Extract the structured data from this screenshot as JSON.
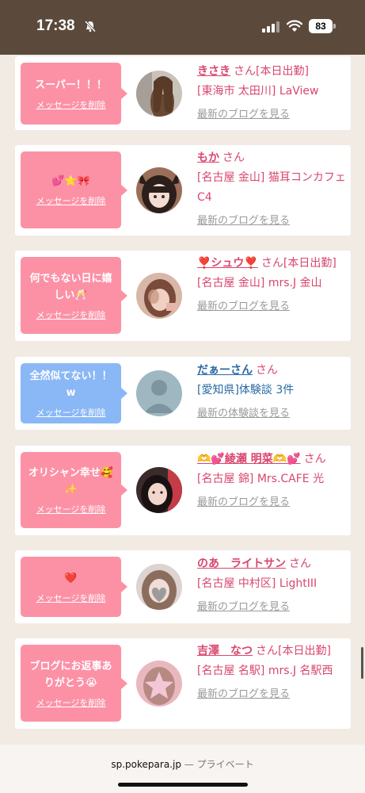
{
  "status": {
    "time": "17:38",
    "battery": "83"
  },
  "feed": [
    {
      "message": "スーパー！！！",
      "delete_label": "メッセージを削除",
      "name": "きさき",
      "san": "さん",
      "badge": "[本日出勤]",
      "detail": "[東海市 太田川] LaView",
      "link": "最新のブログを見る"
    },
    {
      "message": "💕⭐🎀",
      "delete_label": "メッセージを削除",
      "name": "もか",
      "san": "さん",
      "badge": "",
      "detail": "[名古屋 金山] 猫耳コンカフェ C4",
      "link": "最新のブログを見る"
    },
    {
      "message": "何でもない日に嬉しい🥂",
      "delete_label": "メッセージを削除",
      "name": "❣️シュウ❣️",
      "san": "さん",
      "badge": "[本日出勤]",
      "detail": "[名古屋 金山] mrs.J 金山",
      "link": "最新のブログを見る"
    },
    {
      "message": "全然似てない！！w",
      "delete_label": "メッセージを削除",
      "name": "だぁーさん",
      "san": "さん",
      "badge": "",
      "detail": "[愛知県]体験談 3件",
      "link": "最新の体験談を見る"
    },
    {
      "message": "オリシャン幸せ🥰✨",
      "delete_label": "メッセージを削除",
      "name": "🫶💕綾瀬 明菜🫶💕",
      "san": "さん",
      "badge": "",
      "detail": "[名古屋 錦] Mrs.CAFE 光",
      "link": "最新のブログを見る"
    },
    {
      "message": "❤️",
      "delete_label": "メッセージを削除",
      "name": "のあ　ライトサン",
      "san": "さん",
      "badge": "",
      "detail": "[名古屋 中村区] LightIII",
      "link": "最新のブログを見る"
    },
    {
      "message": "ブログにお返事ありがとう😭",
      "delete_label": "メッセージを削除",
      "name": "吉澤　なつ",
      "san": "さん",
      "badge": "[本日出勤]",
      "detail": "[名古屋 名駅] mrs.J 名駅西",
      "link": "最新のブログを見る"
    }
  ],
  "browser": {
    "host": "sp.pokepara.jp",
    "separator": "—",
    "mode": "プライベート"
  },
  "colors": {
    "bubble_pink": "#fc91a6",
    "bubble_blue": "#8ab7f6",
    "name_pink": "#d9466e",
    "name_blue": "#2c6aa4"
  }
}
